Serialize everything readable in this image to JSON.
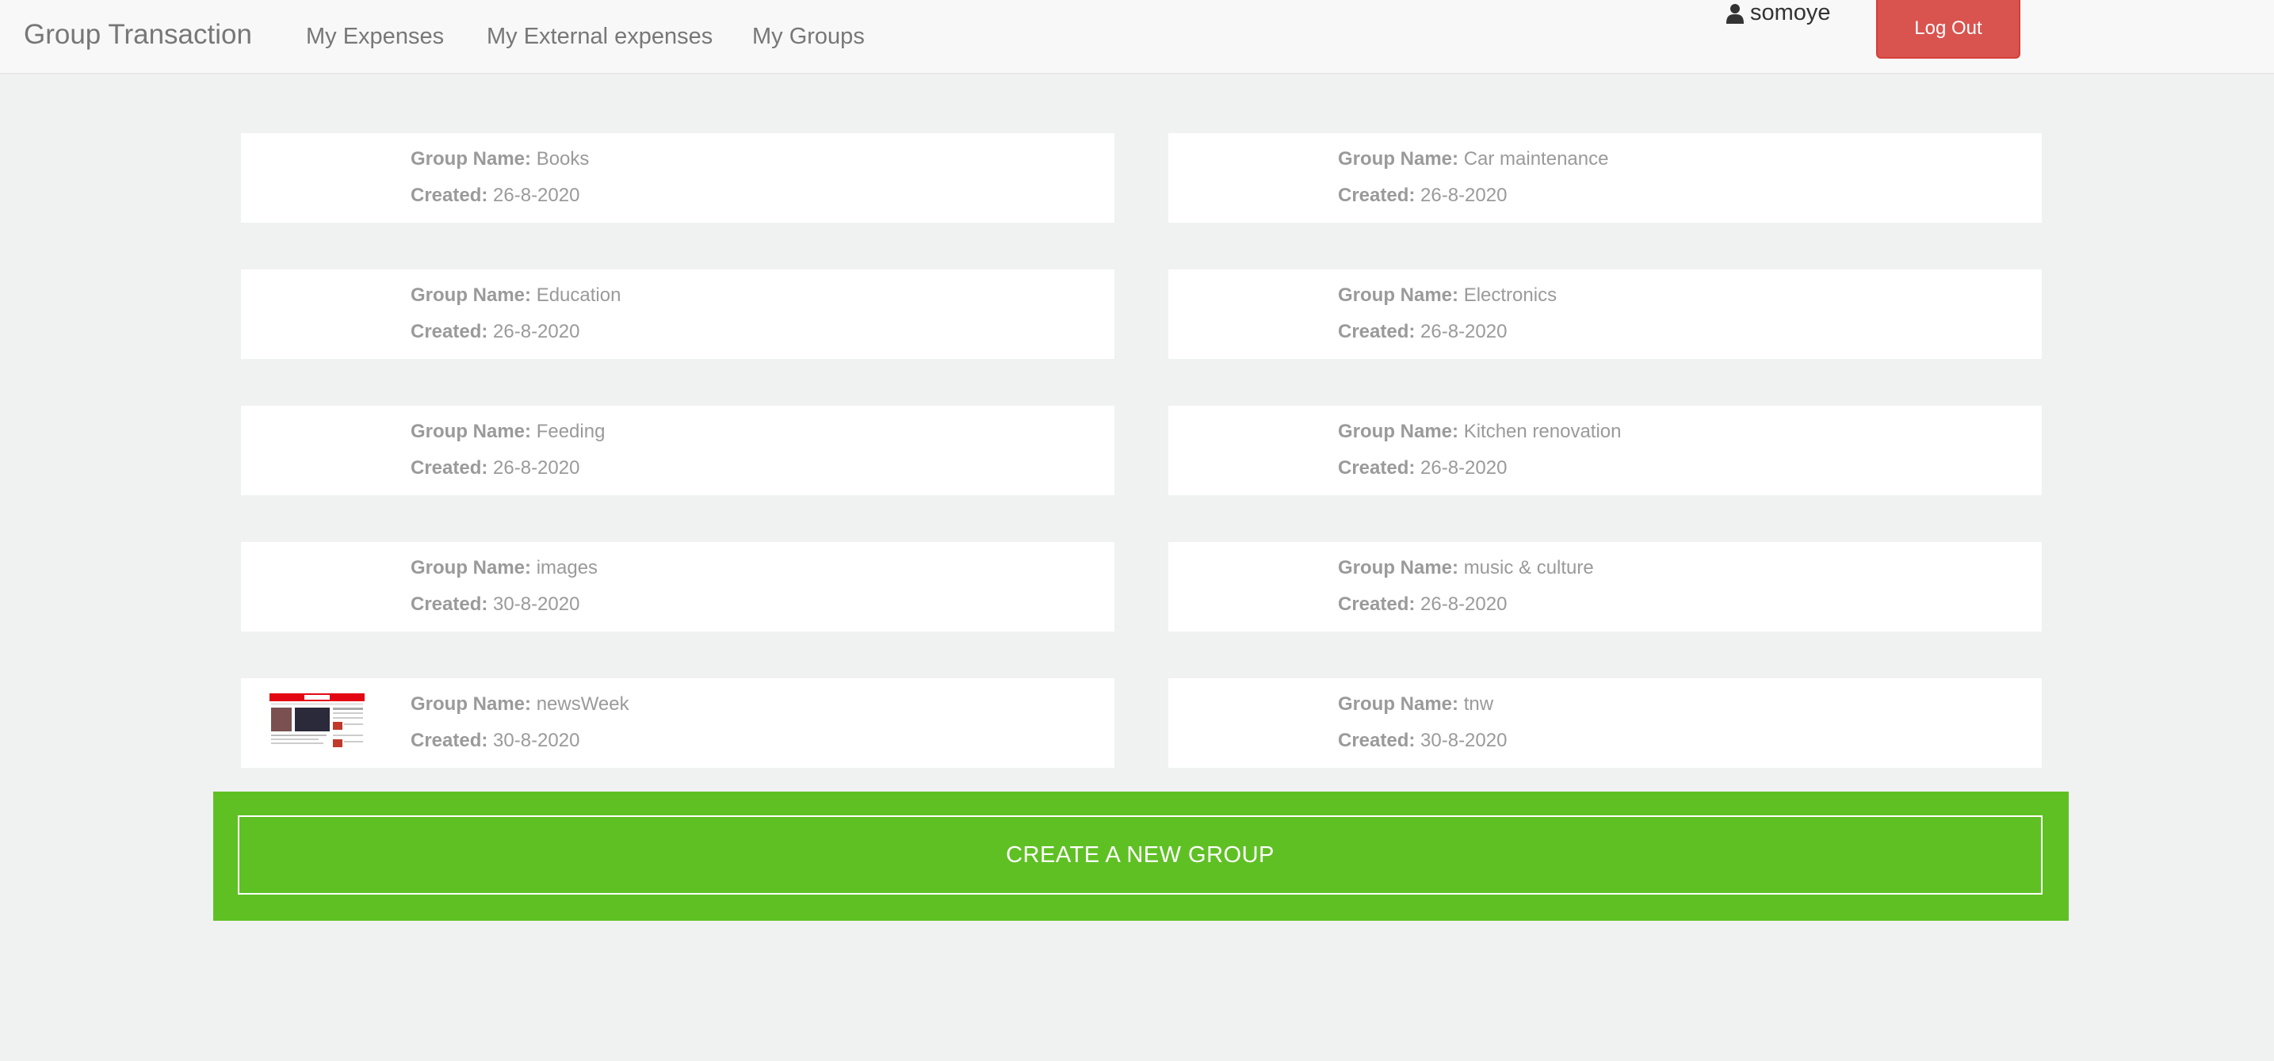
{
  "navbar": {
    "brand": "Group Transaction",
    "links": [
      "My Expenses",
      "My External expenses",
      "My Groups"
    ],
    "username": "somoye",
    "logout_label": "Log Out"
  },
  "labels": {
    "group_name": "Group Name:",
    "created": "Created:"
  },
  "groups": [
    {
      "name": "Books",
      "created": "26-8-2020"
    },
    {
      "name": "Car maintenance",
      "created": "26-8-2020"
    },
    {
      "name": "Education",
      "created": "26-8-2020"
    },
    {
      "name": "Electronics",
      "created": "26-8-2020"
    },
    {
      "name": "Feeding",
      "created": "26-8-2020"
    },
    {
      "name": "Kitchen renovation",
      "created": "26-8-2020"
    },
    {
      "name": "images",
      "created": "30-8-2020"
    },
    {
      "name": "music & culture",
      "created": "26-8-2020"
    },
    {
      "name": "newsWeek",
      "created": "30-8-2020"
    },
    {
      "name": "tnw",
      "created": "30-8-2020"
    }
  ],
  "create_button_label": "CREATE A NEW GROUP",
  "colors": {
    "create_bg": "#5fc024",
    "logout_bg": "#d9534f",
    "page_bg": "#f0f2f1"
  }
}
